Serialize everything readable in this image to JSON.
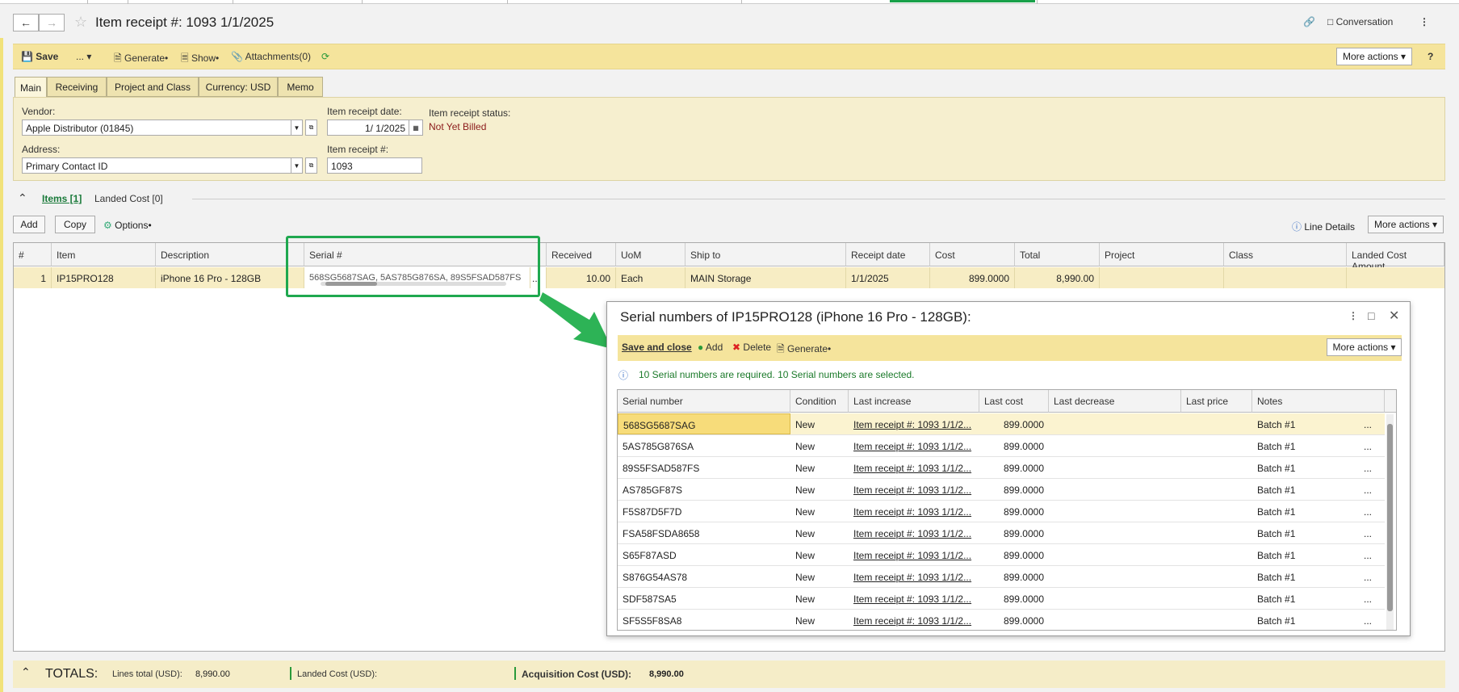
{
  "window": {
    "title": "Item receipt #: 1093 1/1/2025",
    "conversation_label": "Conversation"
  },
  "toolbar": {
    "save": "Save",
    "more_dots": "...",
    "generate": "Generate",
    "show": "Show",
    "attachments": "Attachments(0)",
    "more_actions": "More actions",
    "help": "?"
  },
  "tabs": [
    "Main",
    "Receiving",
    "Project and Class",
    "Currency: USD",
    "Memo"
  ],
  "form": {
    "vendor_label": "Vendor:",
    "vendor_value": "Apple Distributor (01845)",
    "address_label": "Address:",
    "address_value": "Primary Contact ID",
    "receipt_date_label": "Item receipt date:",
    "receipt_date_value": "1/ 1/2025",
    "receipt_no_label": "Item receipt #:",
    "receipt_no_value": "1093",
    "status_label": "Item receipt status:",
    "status_value": "Not Yet Billed",
    "status_color": "#8b1a1a"
  },
  "sections": {
    "items": "Items [1]",
    "landed": "Landed Cost [0]"
  },
  "grid_toolbar": {
    "add": "Add",
    "copy": "Copy",
    "options": "Options",
    "line_details": "Line Details",
    "more_actions": "More actions"
  },
  "grid": {
    "headers": [
      "#",
      "Item",
      "Description",
      "Serial #",
      "Received",
      "UoM",
      "Ship to",
      "Receipt date",
      "Cost",
      "Total",
      "Project",
      "Class",
      "Landed Cost Amount"
    ],
    "row": {
      "num": "1",
      "item": "IP15PRO128",
      "description": "iPhone 16 Pro - 128GB",
      "serial": "568SG5687SAG, 5AS785G876SA, 89S5FSAD587FS",
      "received": "10.00",
      "uom": "Each",
      "ship_to": "MAIN Storage",
      "receipt_date": "1/1/2025",
      "cost": "899.0000",
      "total": "8,990.00"
    }
  },
  "totals": {
    "label": "TOTALS:",
    "lines_total_label": "Lines total (USD):",
    "lines_total_value": "8,990.00",
    "landed_cost_label": "Landed Cost (USD):",
    "acq_label": "Acquisition Cost (USD):",
    "acq_value": "8,990.00"
  },
  "dialog": {
    "title": "Serial numbers of IP15PRO128 (iPhone 16 Pro - 128GB):",
    "save_close": "Save and close",
    "add": "Add",
    "delete": "Delete",
    "generate": "Generate",
    "more_actions": "More actions",
    "info": "10 Serial numbers are required. 10 Serial numbers are selected.",
    "headers": [
      "Serial number",
      "Condition",
      "Last increase",
      "Last cost",
      "Last decrease",
      "Last price",
      "Notes"
    ],
    "rows": [
      {
        "serial": "568SG5687SAG",
        "condition": "New",
        "last_increase": "Item receipt #: 1093 1/1/2...",
        "last_cost": "899.0000",
        "notes": "Batch #1"
      },
      {
        "serial": "5AS785G876SA",
        "condition": "New",
        "last_increase": "Item receipt #: 1093 1/1/2...",
        "last_cost": "899.0000",
        "notes": "Batch #1"
      },
      {
        "serial": "89S5FSAD587FS",
        "condition": "New",
        "last_increase": "Item receipt #: 1093 1/1/2...",
        "last_cost": "899.0000",
        "notes": "Batch #1"
      },
      {
        "serial": "AS785GF87S",
        "condition": "New",
        "last_increase": "Item receipt #: 1093 1/1/2...",
        "last_cost": "899.0000",
        "notes": "Batch #1"
      },
      {
        "serial": "F5S87D5F7D",
        "condition": "New",
        "last_increase": "Item receipt #: 1093 1/1/2...",
        "last_cost": "899.0000",
        "notes": "Batch #1"
      },
      {
        "serial": "FSA58FSDA8658",
        "condition": "New",
        "last_increase": "Item receipt #: 1093 1/1/2...",
        "last_cost": "899.0000",
        "notes": "Batch #1"
      },
      {
        "serial": "S65F87ASD",
        "condition": "New",
        "last_increase": "Item receipt #: 1093 1/1/2...",
        "last_cost": "899.0000",
        "notes": "Batch #1"
      },
      {
        "serial": "S876G54AS78",
        "condition": "New",
        "last_increase": "Item receipt #: 1093 1/1/2...",
        "last_cost": "899.0000",
        "notes": "Batch #1"
      },
      {
        "serial": "SDF587SA5",
        "condition": "New",
        "last_increase": "Item receipt #: 1093 1/1/2...",
        "last_cost": "899.0000",
        "notes": "Batch #1"
      },
      {
        "serial": "SF5S5F8SA8",
        "condition": "New",
        "last_increase": "Item receipt #: 1093 1/1/2...",
        "last_cost": "899.0000",
        "notes": "Batch #1"
      }
    ]
  },
  "colors": {
    "accent_green": "#1fa84f",
    "toolbar_yellow": "#f5e49c"
  }
}
